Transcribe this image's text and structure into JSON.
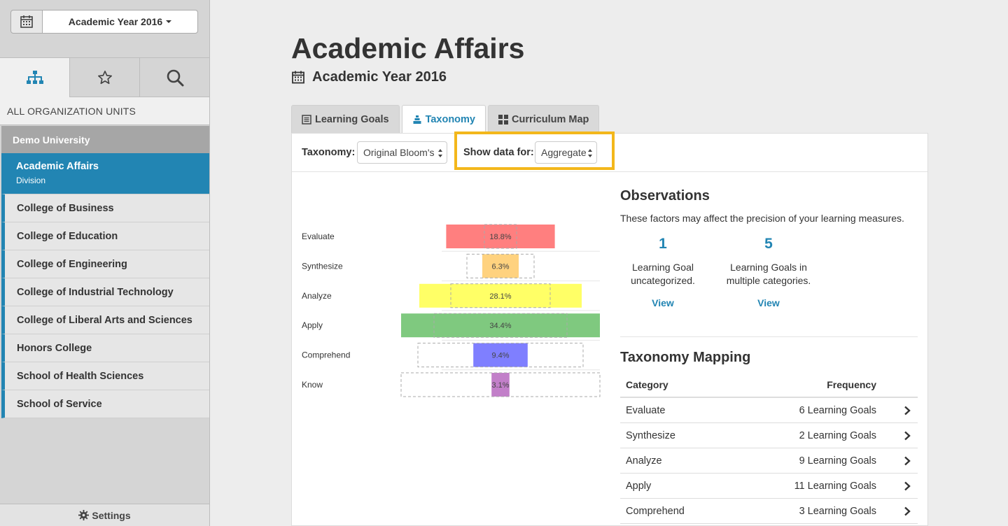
{
  "sidebar": {
    "year_select": "Academic Year 2016",
    "tabs": [
      {
        "icon": "org-chart-icon",
        "active": true
      },
      {
        "icon": "star-icon",
        "active": false
      },
      {
        "icon": "search-icon",
        "active": false
      }
    ],
    "all_units_label": "ALL ORGANIZATION UNITS",
    "root": "Demo University",
    "active_item": {
      "label": "Academic Affairs",
      "sub": "Division"
    },
    "items": [
      "College of Business",
      "College of Education",
      "College of Engineering",
      "College of Industrial Technology",
      "College of Liberal Arts and Sciences",
      "Honors College",
      "School of Health Sciences",
      "School of Service"
    ],
    "settings_label": "Settings"
  },
  "main": {
    "title": "Academic Affairs",
    "subtitle": "Academic Year 2016",
    "tabs": [
      {
        "label": "Learning Goals",
        "icon": "list-icon",
        "active": false
      },
      {
        "label": "Taxonomy",
        "icon": "pyramid-icon",
        "active": true
      },
      {
        "label": "Curriculum Map",
        "icon": "grid-icon",
        "active": false
      }
    ],
    "filters": {
      "taxonomy_label": "Taxonomy:",
      "taxonomy_value": "Original Bloom's",
      "show_label": "Show data for:",
      "show_value": "Aggregate",
      "highlight_color": "#f3b71b"
    }
  },
  "chart_data": {
    "type": "bar",
    "categories": [
      "Evaluate",
      "Synthesize",
      "Analyze",
      "Apply",
      "Comprehend",
      "Know"
    ],
    "values": [
      18.8,
      6.3,
      28.1,
      34.4,
      9.4,
      3.1
    ],
    "value_labels": [
      "18.8%",
      "6.3%",
      "28.1%",
      "34.4%",
      "9.4%",
      "3.1%"
    ],
    "colors": [
      "#ff7f7f",
      "#ffd27f",
      "#ffff66",
      "#7fc97f",
      "#7f7fff",
      "#c27fc9"
    ]
  },
  "observations": {
    "title": "Observations",
    "description": "These factors may affect the precision of your learning measures.",
    "items": [
      {
        "count": "1",
        "line1": "Learning Goal",
        "line2": "uncategorized.",
        "link": "View"
      },
      {
        "count": "5",
        "line1": "Learning Goals in",
        "line2": "multiple categories.",
        "link": "View"
      }
    ]
  },
  "mapping": {
    "title": "Taxonomy Mapping",
    "headers": {
      "category": "Category",
      "frequency": "Frequency"
    },
    "rows": [
      {
        "category": "Evaluate",
        "frequency": "6 Learning Goals"
      },
      {
        "category": "Synthesize",
        "frequency": "2 Learning Goals"
      },
      {
        "category": "Analyze",
        "frequency": "9 Learning Goals"
      },
      {
        "category": "Apply",
        "frequency": "11 Learning Goals"
      },
      {
        "category": "Comprehend",
        "frequency": "3 Learning Goals"
      }
    ]
  },
  "colors": {
    "accent": "#2285b3",
    "highlight": "#f3b71b"
  }
}
